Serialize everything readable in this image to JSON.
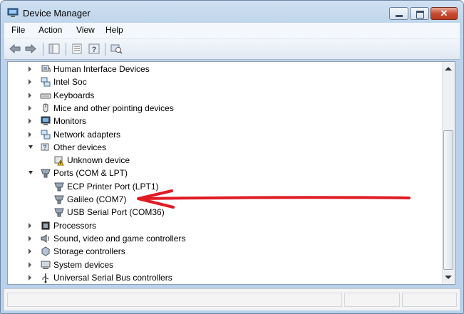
{
  "window": {
    "title": "Device Manager"
  },
  "controls": {
    "close_glyph": "✕"
  },
  "menu": [
    {
      "label": "File"
    },
    {
      "label": "Action"
    },
    {
      "label": "View"
    },
    {
      "label": "Help"
    }
  ],
  "toolbar": [
    "back-icon",
    "forward-icon",
    "show-hide-tree-icon",
    "properties-icon",
    "help-icon",
    "scan-hardware-icon"
  ],
  "tree": {
    "items": [
      {
        "label": "Human Interface Devices",
        "level": 1,
        "state": "collapsed",
        "icon": "hid-icon"
      },
      {
        "label": "Intel Soc",
        "level": 1,
        "state": "collapsed",
        "icon": "network-icon"
      },
      {
        "label": "Keyboards",
        "level": 1,
        "state": "collapsed",
        "icon": "keyboard-icon"
      },
      {
        "label": "Mice and other pointing devices",
        "level": 1,
        "state": "collapsed",
        "icon": "mouse-icon"
      },
      {
        "label": "Monitors",
        "level": 1,
        "state": "collapsed",
        "icon": "monitor-icon"
      },
      {
        "label": "Network adapters",
        "level": 1,
        "state": "collapsed",
        "icon": "network-icon"
      },
      {
        "label": "Other devices",
        "level": 1,
        "state": "expanded",
        "icon": "unknown-devices-icon"
      },
      {
        "label": "Unknown device",
        "level": 2,
        "state": "leaf",
        "icon": "unknown-device-warning-icon"
      },
      {
        "label": "Ports (COM & LPT)",
        "level": 1,
        "state": "expanded",
        "icon": "port-icon"
      },
      {
        "label": "ECP Printer Port (LPT1)",
        "level": 2,
        "state": "leaf",
        "icon": "port-icon"
      },
      {
        "label": "Galileo (COM7)",
        "level": 2,
        "state": "leaf",
        "icon": "port-icon"
      },
      {
        "label": "USB Serial Port (COM36)",
        "level": 2,
        "state": "leaf",
        "icon": "port-icon"
      },
      {
        "label": "Processors",
        "level": 1,
        "state": "collapsed",
        "icon": "processor-icon"
      },
      {
        "label": "Sound, video and game controllers",
        "level": 1,
        "state": "collapsed",
        "icon": "speaker-icon"
      },
      {
        "label": "Storage controllers",
        "level": 1,
        "state": "collapsed",
        "icon": "storage-icon"
      },
      {
        "label": "System devices",
        "level": 1,
        "state": "collapsed",
        "icon": "system-icon"
      },
      {
        "label": "Universal Serial Bus controllers",
        "level": 1,
        "state": "collapsed",
        "icon": "usb-icon"
      }
    ]
  },
  "annotation": {
    "color": "#e01b24",
    "points_to": "Galileo (COM7)"
  },
  "colors": {
    "title_bar": "#c0d6ec",
    "annotation_arrow": "#e01b24"
  }
}
